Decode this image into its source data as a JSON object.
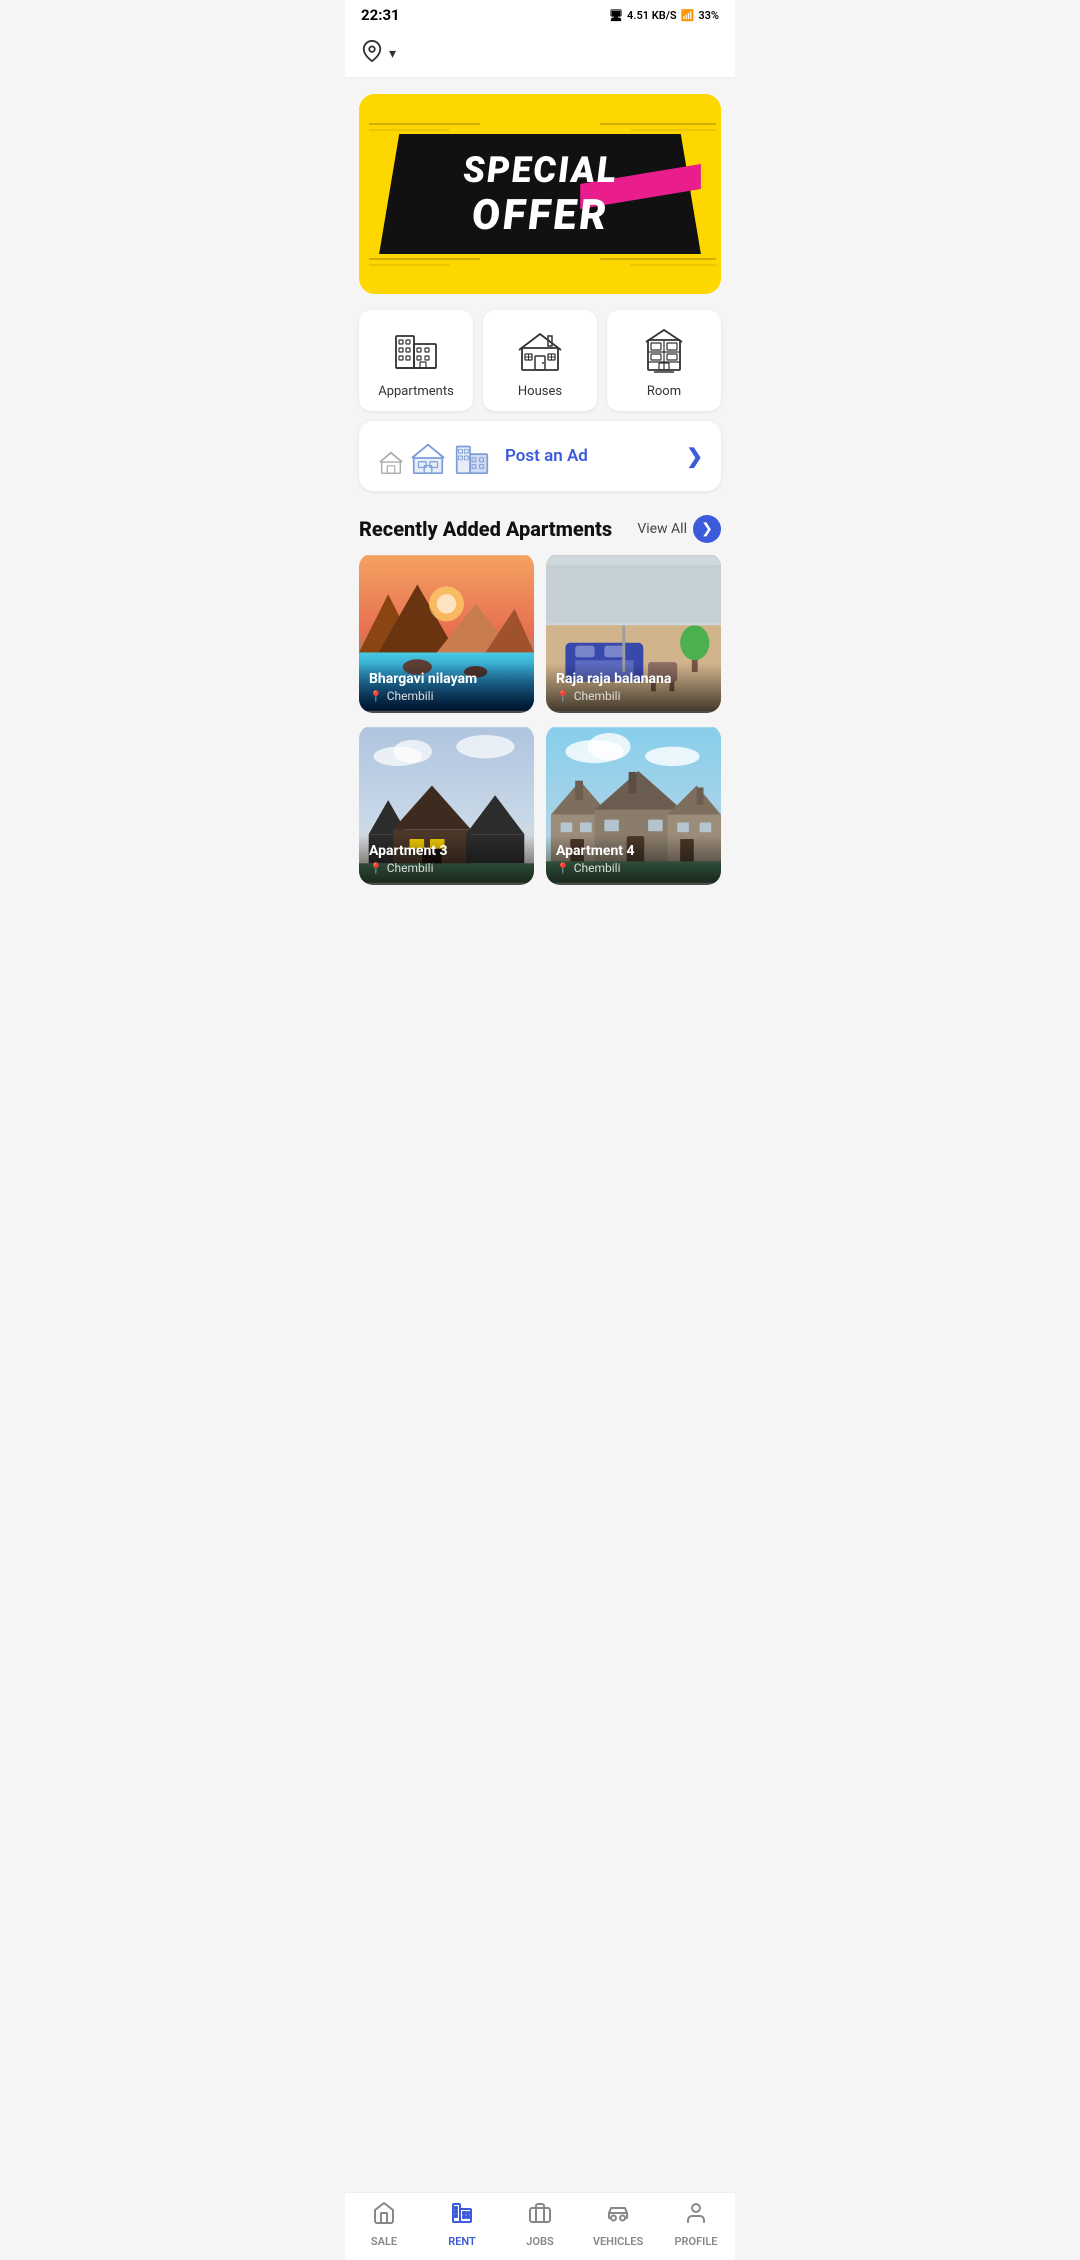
{
  "statusBar": {
    "time": "22:31",
    "speed": "4.51 KB/S",
    "battery": "33%"
  },
  "location": {
    "icon": "📍",
    "chevron": "⌄"
  },
  "banner": {
    "line1": "SPECIAL",
    "line2": "OFFER"
  },
  "categories": [
    {
      "id": "apartments",
      "label": "Appartments"
    },
    {
      "id": "houses",
      "label": "Houses"
    },
    {
      "id": "room",
      "label": "Room"
    }
  ],
  "postAd": {
    "label": "Post an Ad",
    "arrow": "❯"
  },
  "recentSection": {
    "title": "Recently Added Apartments",
    "viewAll": "View All"
  },
  "apartments": [
    {
      "name": "Bhargavi nilayam",
      "location": "Chembili",
      "bgColor1": "#e87c2e",
      "bgColor2": "#3a7bd5",
      "type": "mountain-lake"
    },
    {
      "name": "Raja raja balanana",
      "location": "Chembili",
      "bgColor1": "#c0392b",
      "bgColor2": "#7f8c8d",
      "type": "rooftop"
    },
    {
      "name": "Apartment 3",
      "location": "Chembili",
      "bgColor1": "#2c3e50",
      "bgColor2": "#3498db",
      "type": "house-evening"
    },
    {
      "name": "Apartment 4",
      "location": "Chembili",
      "bgColor1": "#7f8c8d",
      "bgColor2": "#bdc3c7",
      "type": "stone-house"
    }
  ],
  "bottomNav": [
    {
      "id": "sale",
      "label": "SALE",
      "icon": "house",
      "active": false
    },
    {
      "id": "rent",
      "label": "RENT",
      "icon": "building",
      "active": true
    },
    {
      "id": "jobs",
      "label": "JOBS",
      "icon": "briefcase",
      "active": false
    },
    {
      "id": "vehicles",
      "label": "VEHICLES",
      "icon": "car",
      "active": false
    },
    {
      "id": "profile",
      "label": "PROFILE",
      "icon": "person",
      "active": false
    }
  ]
}
